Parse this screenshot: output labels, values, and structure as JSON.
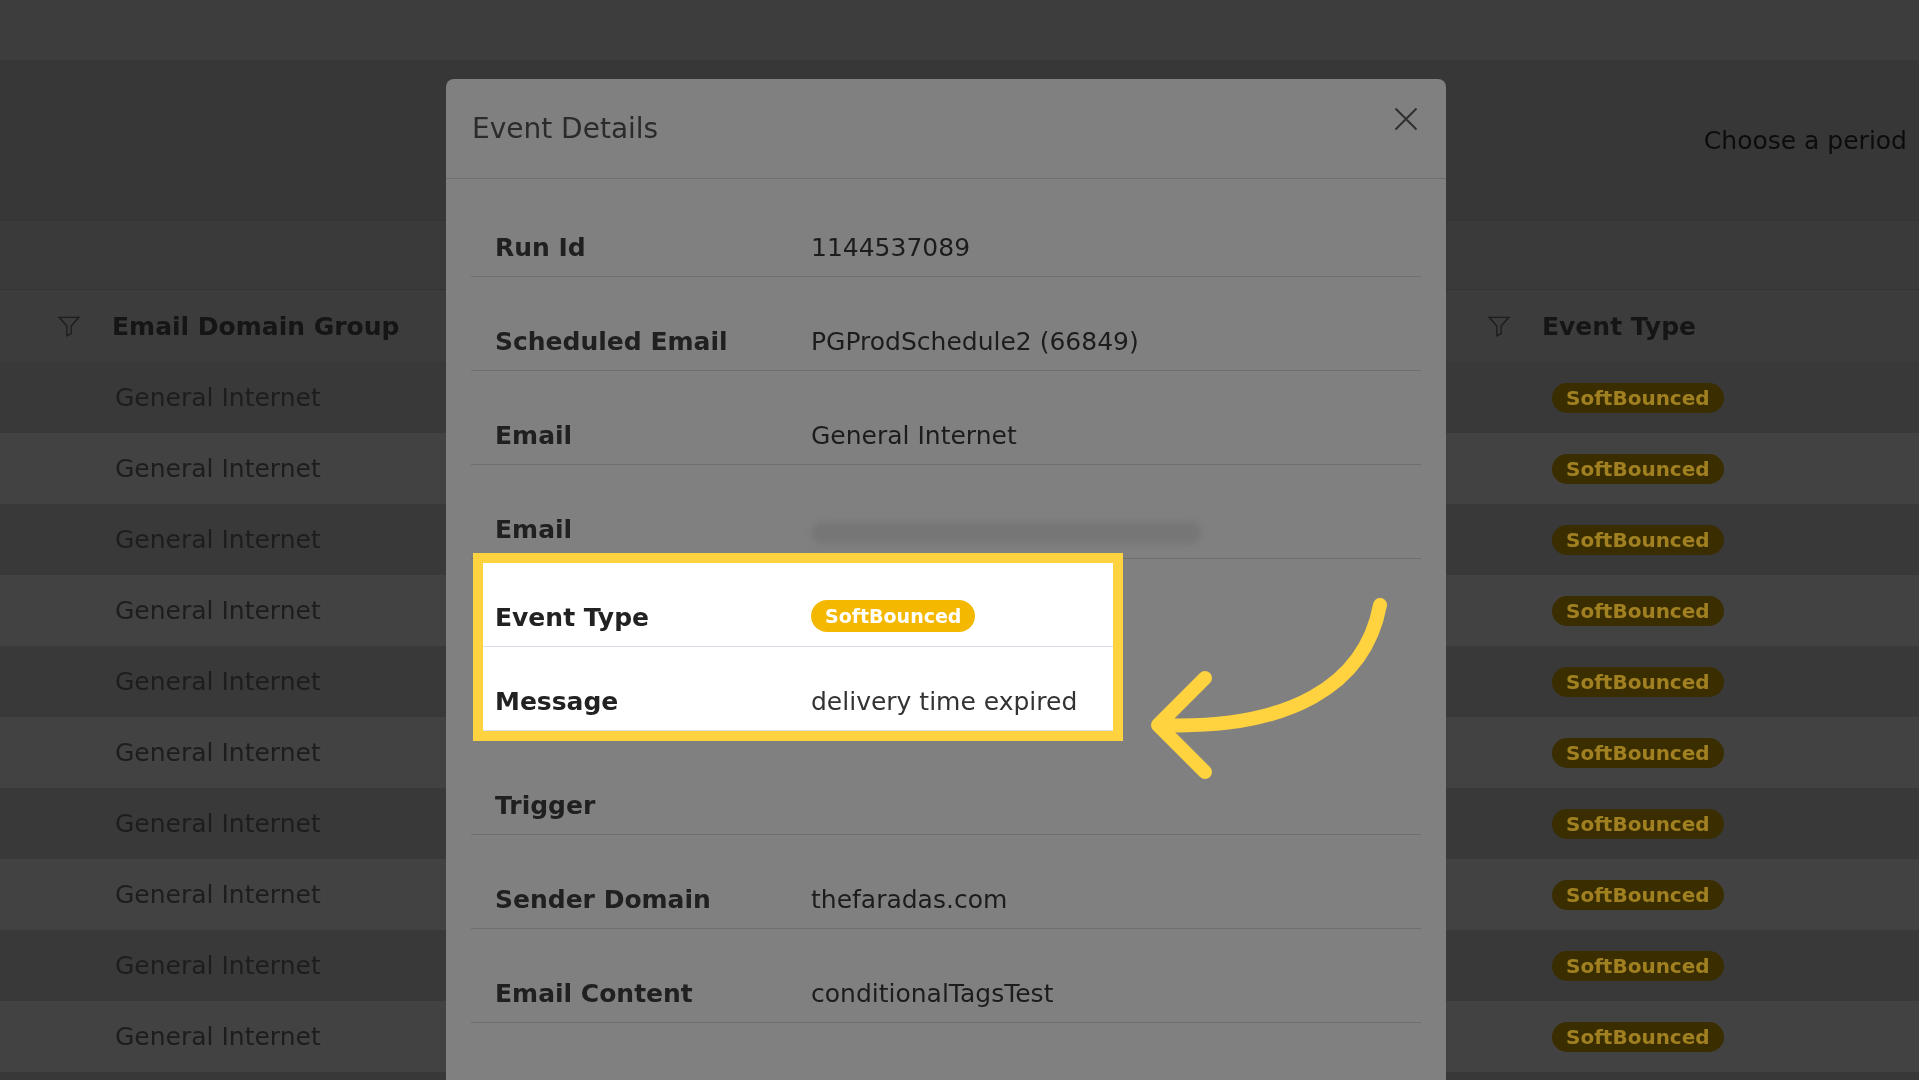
{
  "toolbar": {
    "period_label": "Choose a period"
  },
  "table": {
    "columns": [
      {
        "label": "Email Domain Group",
        "filter": true
      },
      {
        "label": "Event Type",
        "filter": true
      }
    ],
    "rows": [
      {
        "domain_group": "General Internet",
        "event_type": "SoftBounced"
      },
      {
        "domain_group": "General Internet",
        "event_type": "SoftBounced"
      },
      {
        "domain_group": "General Internet",
        "event_type": "SoftBounced"
      },
      {
        "domain_group": "General Internet",
        "event_type": "SoftBounced"
      },
      {
        "domain_group": "General Internet",
        "event_type": "SoftBounced"
      },
      {
        "domain_group": "General Internet",
        "event_type": "SoftBounced"
      },
      {
        "domain_group": "General Internet",
        "event_type": "SoftBounced"
      },
      {
        "domain_group": "General Internet",
        "event_type": "SoftBounced"
      },
      {
        "domain_group": "General Internet",
        "event_type": "SoftBounced"
      },
      {
        "domain_group": "General Internet",
        "event_type": "SoftBounced"
      }
    ]
  },
  "dialog": {
    "title": "Event Details",
    "fields": [
      {
        "label": "Run Id",
        "kind": "text",
        "value": "1144537089",
        "highlighted": false
      },
      {
        "label": "Scheduled Email",
        "kind": "text",
        "value": "PGProdSchedule2 (66849)",
        "highlighted": false
      },
      {
        "label": "Email",
        "kind": "text",
        "value": "General Internet",
        "highlighted": false
      },
      {
        "label": "Email",
        "kind": "redacted",
        "highlighted": false
      },
      {
        "label": "Event Type",
        "kind": "badge",
        "value": "SoftBounced",
        "highlighted": true
      },
      {
        "label": "Message",
        "kind": "text",
        "value": "delivery time expired",
        "highlighted": true
      },
      {
        "label": "Trigger",
        "kind": "text",
        "highlighted": false
      },
      {
        "label": "Sender Domain",
        "kind": "text",
        "value": "thefaradas.com",
        "highlighted": false
      },
      {
        "label": "Email Content",
        "kind": "text",
        "value": "conditionalTagsTest",
        "highlighted": false
      }
    ]
  }
}
